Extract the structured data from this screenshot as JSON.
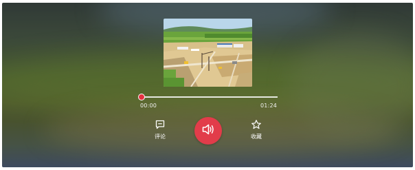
{
  "player": {
    "progress": {
      "current_time": "00:00",
      "total_time": "01:24",
      "fraction": 0.0
    },
    "actions": {
      "comment_label": "评论",
      "favorite_label": "收藏"
    },
    "icons": {
      "comment": "comment-icon",
      "volume": "volume-icon",
      "favorite": "star-icon"
    },
    "colors": {
      "accent": "#e23c4a",
      "progress_knob": "#e5313f",
      "track": "#ffffff"
    }
  }
}
